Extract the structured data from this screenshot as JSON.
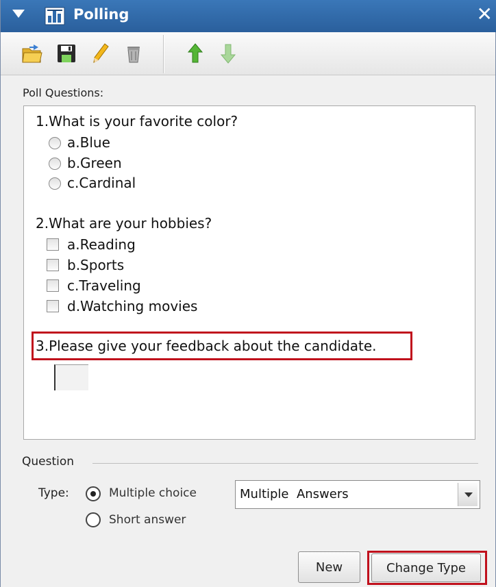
{
  "window": {
    "title": "Polling",
    "close_glyph": "✕"
  },
  "toolbar": {
    "buttons": [
      "open-icon",
      "save-icon",
      "edit-icon",
      "delete-icon",
      "move-up-icon",
      "move-down-icon"
    ]
  },
  "poll": {
    "label": "Poll Questions:",
    "questions": [
      {
        "text": "1.What is your favorite color?",
        "type": "radio",
        "options": [
          "a.Blue",
          "b.Green",
          "c.Cardinal"
        ]
      },
      {
        "text": "2.What are your hobbies?",
        "type": "checkbox",
        "options": [
          "a.Reading",
          "b.Sports",
          "c.Traveling",
          "d.Watching movies"
        ]
      },
      {
        "text": "3.Please give your feedback about the candidate.",
        "type": "short-answer",
        "options": []
      }
    ]
  },
  "question": {
    "section_label": "Question",
    "type_label": "Type:",
    "type_options": [
      "Multiple choice",
      "Short answer"
    ],
    "selected_type": "Multiple choice",
    "answers_select": "Multiple  Answers"
  },
  "buttons": {
    "new_label": "New",
    "change_type_label": "Change Type"
  },
  "colors": {
    "titlebar": "#2f6aab",
    "highlight": "#c0101c"
  }
}
